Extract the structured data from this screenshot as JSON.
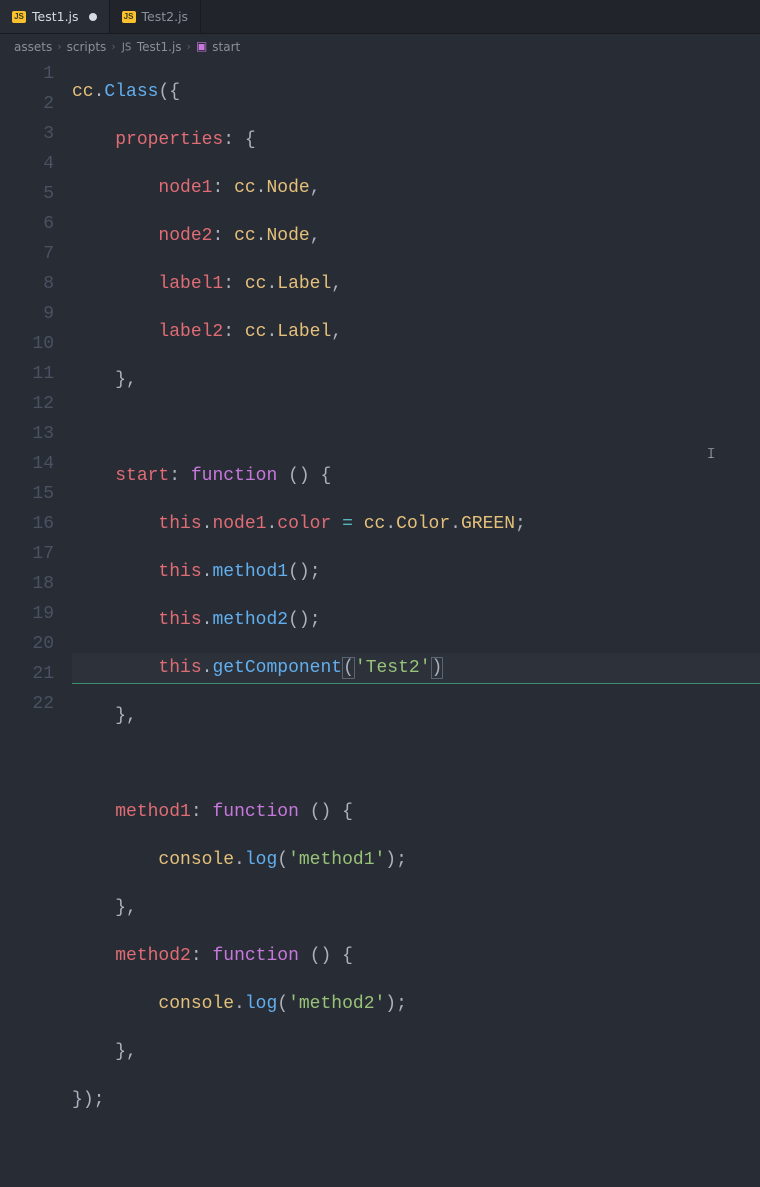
{
  "tabs": [
    {
      "label": "Test1.js",
      "active": true,
      "dirty": true
    },
    {
      "label": "Test2.js",
      "active": false,
      "dirty": false
    }
  ],
  "js_badge": "JS",
  "breadcrumbs": {
    "seg0": "assets",
    "seg1": "scripts",
    "seg2": "Test1.js",
    "seg3": "start"
  },
  "line_numbers": [
    "1",
    "2",
    "3",
    "4",
    "5",
    "6",
    "7",
    "8",
    "9",
    "10",
    "11",
    "12",
    "13",
    "14",
    "15",
    "16",
    "17",
    "18",
    "19",
    "20",
    "21",
    "22"
  ],
  "code": {
    "cc": "cc",
    "Class": "Class",
    "properties": "properties",
    "node1": "node1",
    "node2": "node2",
    "label1": "label1",
    "label2": "label2",
    "Node": "Node",
    "Label": "Label",
    "start": "start",
    "function": "function",
    "this": "this",
    "color": "color",
    "Color": "Color",
    "GREEN": "GREEN",
    "method1": "method1",
    "method2": "method2",
    "getComponent": "getComponent",
    "Test2str": "'Test2'",
    "console": "console",
    "log": "log",
    "method1str": "'method1'",
    "method2str": "'method2'",
    "eq": "=",
    "dot": ".",
    "comma": ",",
    "colon": ":",
    "semi": ";",
    "lparen": "(",
    "rparen": ")",
    "lbrace": "{",
    "rbrace": "}"
  }
}
